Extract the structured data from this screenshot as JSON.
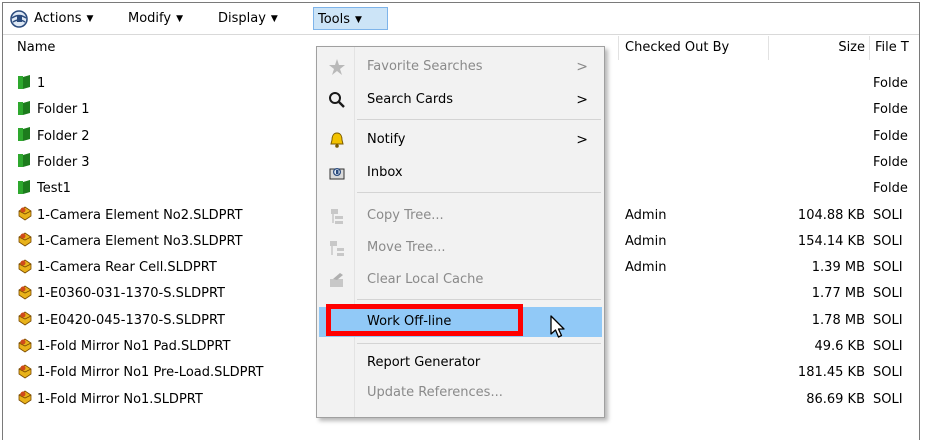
{
  "toolbar": {
    "actions_label": "Actions",
    "modify_label": "Modify",
    "display_label": "Display",
    "tools_label": "Tools"
  },
  "columns": {
    "name": "Name",
    "checked_out_by": "Checked Out By",
    "size": "Size",
    "file_type": "File T"
  },
  "rows": [
    {
      "name": "1",
      "icon": "folder-icon",
      "checked_out_by": "",
      "size": "",
      "type": "Folde"
    },
    {
      "name": "Folder 1",
      "icon": "folder-icon",
      "checked_out_by": "",
      "size": "",
      "type": "Folde"
    },
    {
      "name": "Folder 2",
      "icon": "folder-icon",
      "checked_out_by": "",
      "size": "",
      "type": "Folde"
    },
    {
      "name": "Folder 3",
      "icon": "folder-icon",
      "checked_out_by": "",
      "size": "",
      "type": "Folde"
    },
    {
      "name": "Test1",
      "icon": "folder-icon",
      "checked_out_by": "",
      "size": "",
      "type": "Folde"
    },
    {
      "name": "1-Camera Element No2.SLDPRT",
      "icon": "part-icon",
      "checked_out_by": "Admin",
      "size": "104.88 KB",
      "type": "SOLI"
    },
    {
      "name": "1-Camera Element No3.SLDPRT",
      "icon": "part-icon",
      "checked_out_by": "Admin",
      "size": "154.14 KB",
      "type": "SOLI"
    },
    {
      "name": "1-Camera Rear Cell.SLDPRT",
      "icon": "part-icon",
      "checked_out_by": "Admin",
      "size": "1.39 MB",
      "type": "SOLI"
    },
    {
      "name": "1-E0360-031-1370-S.SLDPRT",
      "icon": "part-icon",
      "checked_out_by": "",
      "size": "1.77 MB",
      "type": "SOLI"
    },
    {
      "name": "1-E0420-045-1370-S.SLDPRT",
      "icon": "part-icon",
      "checked_out_by": "",
      "size": "1.78 MB",
      "type": "SOLI"
    },
    {
      "name": "1-Fold Mirror No1 Pad.SLDPRT",
      "icon": "part-icon",
      "checked_out_by": "",
      "size": "49.6 KB",
      "type": "SOLI"
    },
    {
      "name": "1-Fold Mirror No1 Pre-Load.SLDPRT",
      "icon": "part-icon",
      "checked_out_by": "",
      "size": "181.45 KB",
      "type": "SOLI"
    },
    {
      "name": "1-Fold Mirror No1.SLDPRT",
      "icon": "part-icon",
      "checked_out_by": "",
      "size": "86.69 KB",
      "type": "SOLI"
    }
  ],
  "tools_menu": {
    "items": [
      {
        "label": "Favorite Searches",
        "icon": "star-folder-icon",
        "enabled": false,
        "submenu": true
      },
      {
        "label": "Search Cards",
        "icon": "search-icon",
        "enabled": true,
        "submenu": true
      },
      {
        "label": "Notify",
        "icon": "bell-icon",
        "enabled": true,
        "submenu": true
      },
      {
        "label": "Inbox",
        "icon": "inbox-icon",
        "enabled": true,
        "submenu": false
      },
      {
        "label": "Copy Tree...",
        "icon": "copy-tree-icon",
        "enabled": false,
        "submenu": false
      },
      {
        "label": "Move Tree...",
        "icon": "move-tree-icon",
        "enabled": false,
        "submenu": false
      },
      {
        "label": "Clear Local Cache",
        "icon": "clear-cache-icon",
        "enabled": false,
        "submenu": false
      },
      {
        "label": "Work Off-line",
        "icon": "",
        "enabled": true,
        "submenu": false,
        "highlighted": true
      },
      {
        "label": "Report Generator",
        "icon": "",
        "enabled": true,
        "submenu": false
      },
      {
        "label": "Update References...",
        "icon": "",
        "enabled": false,
        "submenu": false
      }
    ],
    "submenu_arrow": ">"
  },
  "colors": {
    "highlight": "#91c9f7",
    "annotation_box": "#ff0000",
    "folder_green": "#2ea82e",
    "part_yellow": "#e8b21a"
  }
}
